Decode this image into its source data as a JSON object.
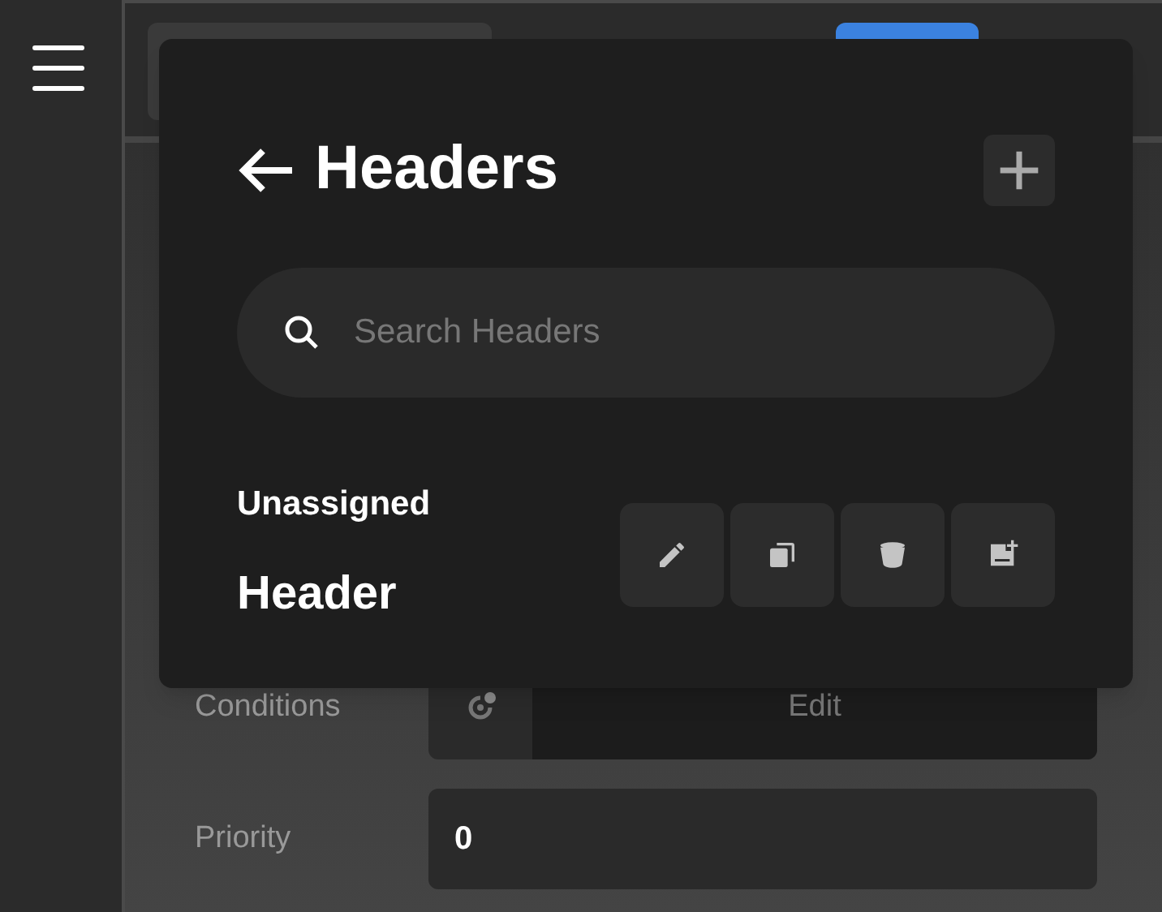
{
  "form": {
    "rows": [
      {
        "label": "Conditions",
        "kind": "conditions",
        "value": "Edit"
      },
      {
        "label": "Priority",
        "kind": "number",
        "value": "0"
      }
    ]
  },
  "popup": {
    "title": "Headers",
    "search": {
      "placeholder": "Search Headers"
    },
    "groups": [
      {
        "label": "Unassigned",
        "items": [
          {
            "name": "Header"
          }
        ]
      }
    ]
  }
}
